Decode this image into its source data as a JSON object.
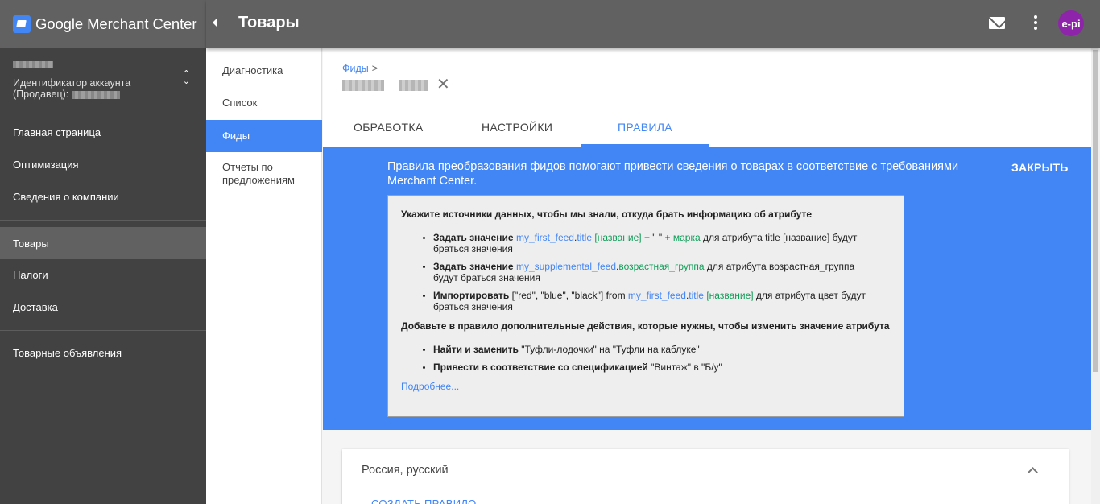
{
  "app": {
    "brand": "Google Merchant Center"
  },
  "header": {
    "page_title": "Товары",
    "avatar_text": "e-pi"
  },
  "account": {
    "label_line1": "Идентификатор аккаунта",
    "label_line2": "(Продавец):"
  },
  "sidebar": {
    "items": [
      {
        "label": "Главная страница"
      },
      {
        "label": "Оптимизация"
      },
      {
        "label": "Сведения о компании"
      },
      {
        "label": "Товары",
        "active": true
      },
      {
        "label": "Налоги"
      },
      {
        "label": "Доставка"
      },
      {
        "label": "Товарные объявления"
      }
    ]
  },
  "subnav": {
    "items": [
      {
        "label": "Диагностика"
      },
      {
        "label": "Список"
      },
      {
        "label": "Фиды",
        "active": true
      },
      {
        "label": "Отчеты по предложениям"
      }
    ]
  },
  "breadcrumb": {
    "parent": "Фиды",
    "separator": ">"
  },
  "tabs": [
    {
      "label": "ОБРАБОТКА"
    },
    {
      "label": "НАСТРОЙКИ"
    },
    {
      "label": "ПРАВИЛА",
      "active": true
    }
  ],
  "banner": {
    "text": "Правила преобразования фидов помогают привести сведения о товарах в соответствие с требованиями Merchant Center.",
    "close_label": "ЗАКРЫТЬ",
    "card": {
      "heading1": "Укажите источники данных, чтобы мы знали, откуда брать информацию об атрибуте",
      "list1": [
        {
          "bold": "Задать значение",
          "feed": "my_first_feed",
          "dot": ".",
          "attr": "title",
          "bracket": "[название]",
          "tail1": " + \" \" + ",
          "attr2": "марка",
          "tail2": " для атрибута title [название] будут браться значения"
        },
        {
          "bold": "Задать значение",
          "feed": "my_supplemental_feed",
          "dot": ".",
          "attr": "возрастная_группа",
          "tail2": " для атрибута возрастная_группа будут браться значения"
        },
        {
          "bold": "Импортировать",
          "pre": " [\"red\", \"blue\", \"black\"] from ",
          "feed": "my_first_feed",
          "dot": ".",
          "attr": "title",
          "bracket": "[название]",
          "tail2": " для атрибута цвет будут браться значения"
        }
      ],
      "heading2": "Добавьте в правило дополнительные действия, которые нужны, чтобы изменить значение атрибута",
      "list2": [
        {
          "bold": "Найти и заменить",
          "rest": " \"Туфли-лодочки\" на \"Туфли на каблуке\""
        },
        {
          "bold": "Привести в соответствие со спецификацией",
          "rest": " \"Винтаж\" в \"Б/у\""
        }
      ],
      "more_link": "Подробнее..."
    }
  },
  "rules_section": {
    "title": "Россия, русский",
    "create_label": "СОЗДАТЬ ПРАВИЛО"
  },
  "colors": {
    "accent": "#4285f4",
    "sidebar": "#424242",
    "header": "#616161",
    "avatar": "#8e24aa",
    "green": "#0f9d58"
  }
}
